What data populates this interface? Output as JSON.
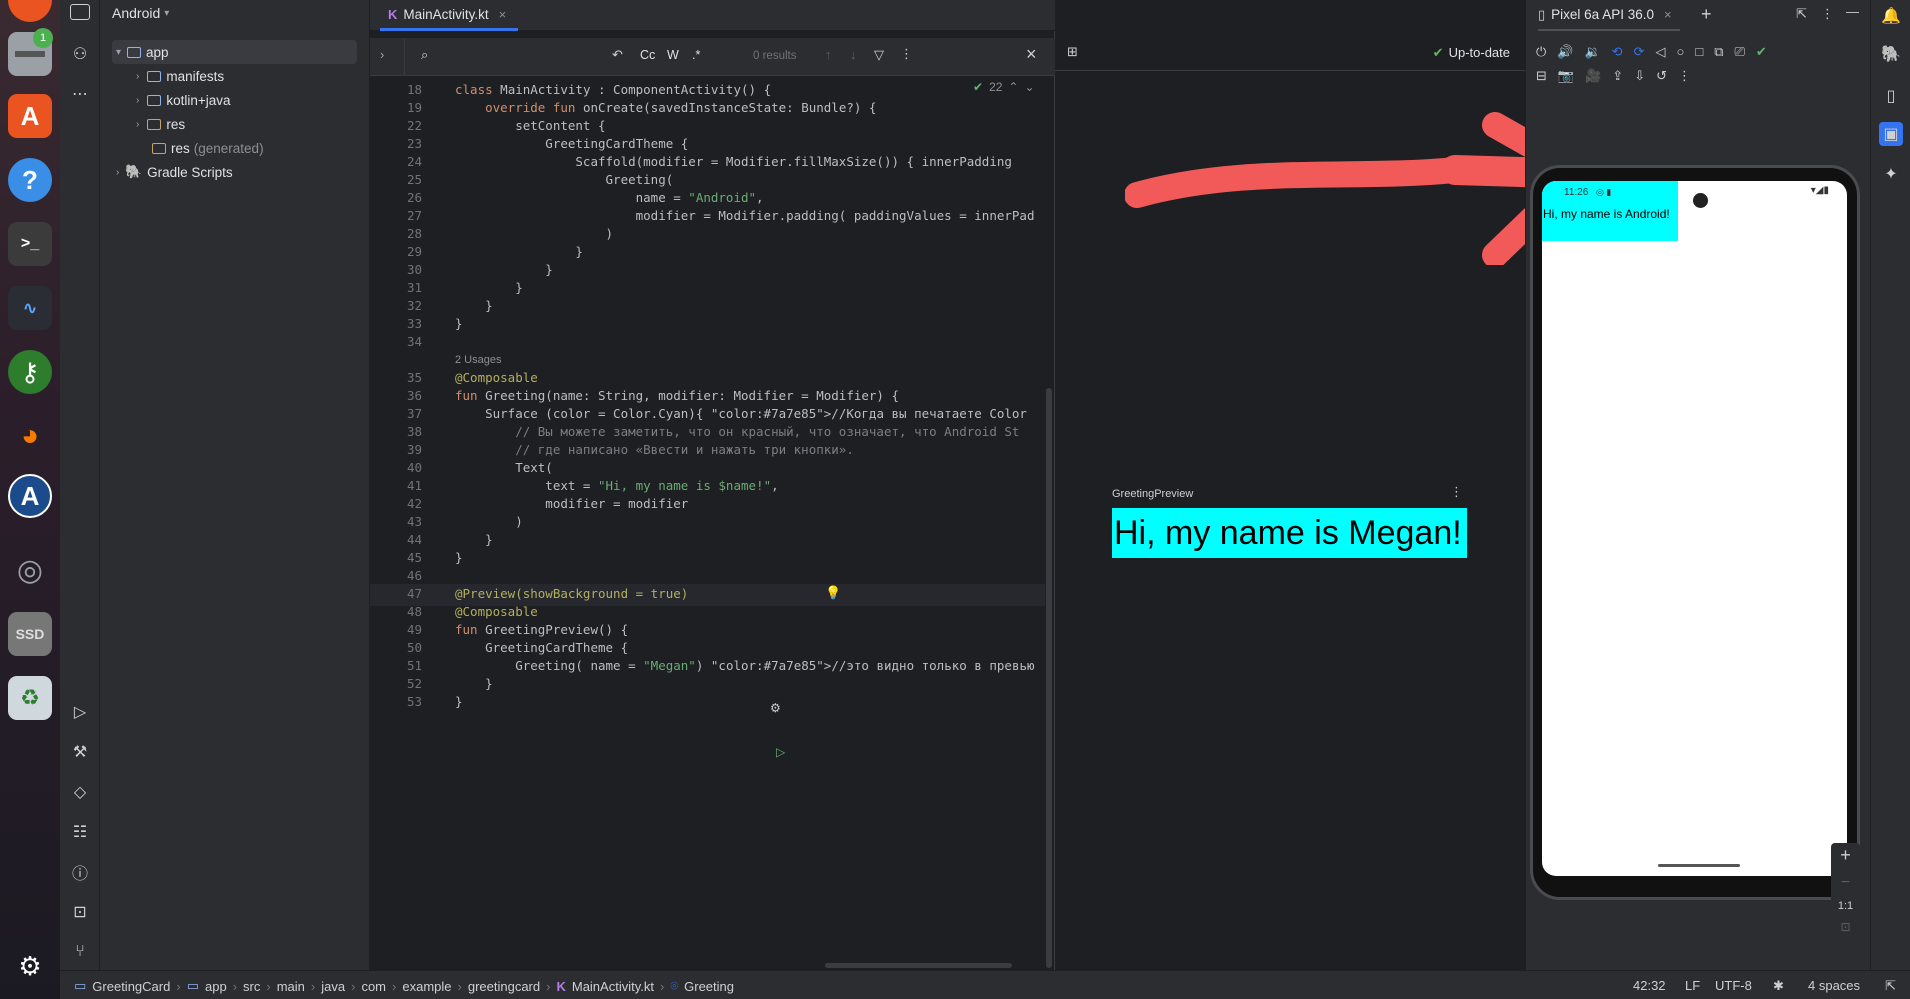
{
  "project": {
    "view_label": "Android",
    "tree": [
      "app",
      "manifests",
      "kotlin+java",
      "res",
      "res",
      "(generated)",
      "Gradle Scripts"
    ]
  },
  "editor": {
    "tab_label": "MainActivity.kt",
    "find": {
      "options": [
        "Cc",
        "W",
        ".*"
      ],
      "results": "0 results"
    },
    "inspections_count": "22",
    "lines": [
      {
        "n": "18",
        "t": "class MainActivity : ComponentActivity() {"
      },
      {
        "n": "19",
        "t": "    override fun onCreate(savedInstanceState: Bundle?) {"
      },
      {
        "n": "22",
        "t": "        setContent {"
      },
      {
        "n": "23",
        "t": "            GreetingCardTheme {"
      },
      {
        "n": "24",
        "t": "                Scaffold(modifier = Modifier.fillMaxSize()) { innerPadding"
      },
      {
        "n": "25",
        "t": "                    Greeting("
      },
      {
        "n": "26",
        "t": "                        name = \"Android\","
      },
      {
        "n": "27",
        "t": "                        modifier = Modifier.padding( paddingValues = innerPad"
      },
      {
        "n": "28",
        "t": "                    )"
      },
      {
        "n": "29",
        "t": "                }"
      },
      {
        "n": "30",
        "t": "            }"
      },
      {
        "n": "31",
        "t": "        }"
      },
      {
        "n": "32",
        "t": "    }"
      },
      {
        "n": "33",
        "t": "}"
      },
      {
        "n": "34",
        "t": ""
      },
      {
        "n": "",
        "t": "2 Usages"
      },
      {
        "n": "35",
        "t": "@Composable"
      },
      {
        "n": "36",
        "t": "fun Greeting(name: String, modifier: Modifier = Modifier) {"
      },
      {
        "n": "37",
        "t": "    Surface (color = Color.Cyan){ //Когда вы печатаете Color"
      },
      {
        "n": "38",
        "t": "        // Вы можете заметить, что он красный, что означает, что Android St"
      },
      {
        "n": "39",
        "t": "        // где написано «Ввести и нажать три кнопки»."
      },
      {
        "n": "40",
        "t": "        Text("
      },
      {
        "n": "41",
        "t": "            text = \"Hi, my name is $name!\","
      },
      {
        "n": "42",
        "t": "            modifier = modifier"
      },
      {
        "n": "43",
        "t": "        )"
      },
      {
        "n": "44",
        "t": "    }"
      },
      {
        "n": "45",
        "t": "}"
      },
      {
        "n": "46",
        "t": ""
      },
      {
        "n": "47",
        "t": "@Preview(showBackground = true)"
      },
      {
        "n": "48",
        "t": "@Composable"
      },
      {
        "n": "49",
        "t": "fun GreetingPreview() {"
      },
      {
        "n": "50",
        "t": "    GreetingCardTheme {"
      },
      {
        "n": "51",
        "t": "        Greeting( name = \"Megan\") //это видно только в превью"
      },
      {
        "n": "52",
        "t": "    }"
      },
      {
        "n": "53",
        "t": "}"
      }
    ]
  },
  "preview": {
    "status": "Up-to-date",
    "label": "GreetingPreview",
    "text": "Hi, my name is Megan!",
    "bg_color": "#00ffff"
  },
  "emulator": {
    "tab_label": "Pixel 6a API 36.0",
    "clock": "11:26",
    "app_text": "Hi, my name is Android!",
    "zoom_label": "1:1"
  },
  "dock": {
    "badge": "1"
  },
  "statusbar": {
    "breadcrumbs": [
      "GreetingCard",
      "app",
      "src",
      "main",
      "java",
      "com",
      "example",
      "greetingcard",
      "MainActivity.kt",
      "Greeting"
    ],
    "cursor": "42:32",
    "line_sep": "LF",
    "encoding": "UTF-8",
    "indent": "4 spaces"
  },
  "colors": {
    "accent": "#3574f0",
    "arrow": "#f25a5a",
    "cyan": "#00ffff"
  }
}
